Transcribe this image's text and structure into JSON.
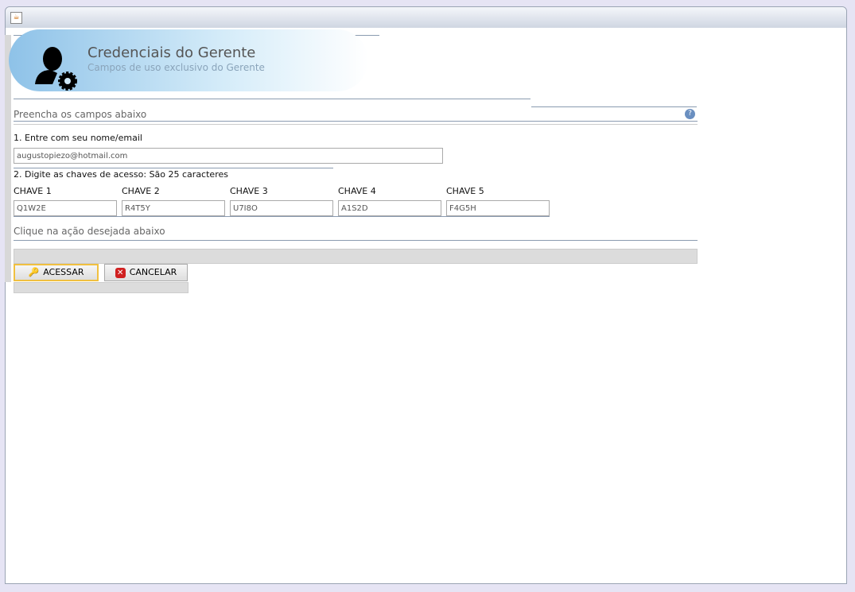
{
  "header": {
    "title": "Credenciais do Gerente",
    "subtitle": "Campos de uso exclusivo do Gerente"
  },
  "section1": "Preencha os campos abaixo",
  "email": {
    "label": "1. Entre com seu nome/email",
    "value": "augustopiezo@hotmail.com"
  },
  "keys": {
    "label": "2. Digite as chaves de acesso: São 25 caracteres",
    "items": [
      {
        "label": "CHAVE 1",
        "value": "Q1W2E"
      },
      {
        "label": "CHAVE 2",
        "value": "R4T5Y"
      },
      {
        "label": "CHAVE 3",
        "value": "U7I8O"
      },
      {
        "label": "CHAVE 4",
        "value": "A1S2D"
      },
      {
        "label": "CHAVE 5",
        "value": "F4G5H"
      }
    ]
  },
  "section2": "Clique na ação desejada abaixo",
  "buttons": {
    "access": "ACESSAR",
    "cancel": "CANCELAR"
  },
  "help_icon": "?"
}
